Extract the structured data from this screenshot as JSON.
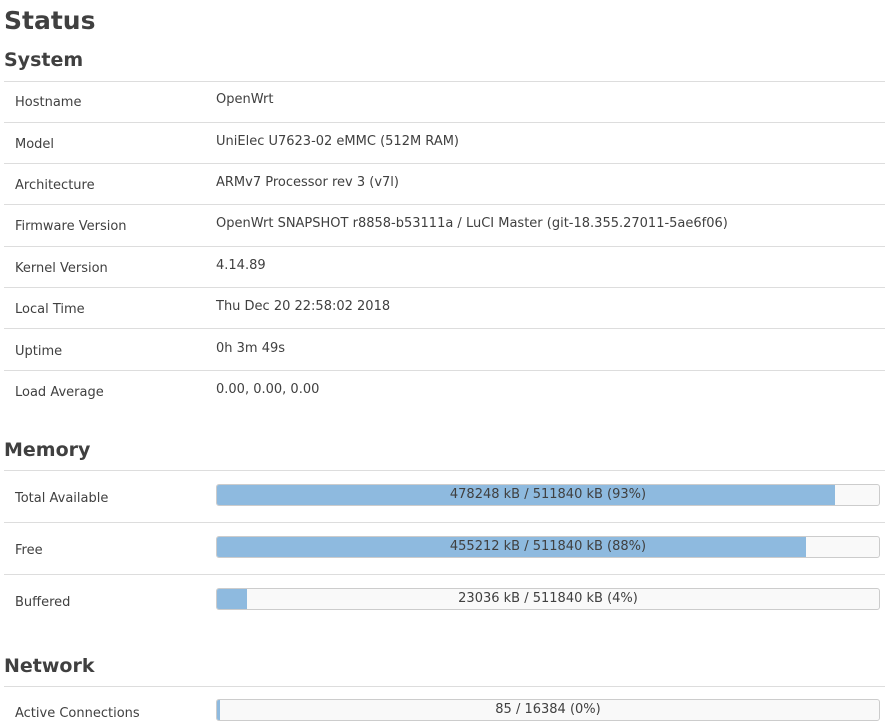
{
  "page": {
    "title": "Status"
  },
  "system": {
    "title": "System",
    "rows": [
      {
        "label": "Hostname",
        "value": "OpenWrt"
      },
      {
        "label": "Model",
        "value": "UniElec U7623-02 eMMC (512M RAM)"
      },
      {
        "label": "Architecture",
        "value": "ARMv7 Processor rev 3 (v7l)"
      },
      {
        "label": "Firmware Version",
        "value": "OpenWrt SNAPSHOT r8858-b53111a / LuCI Master (git-18.355.27011-5ae6f06)"
      },
      {
        "label": "Kernel Version",
        "value": "4.14.89"
      },
      {
        "label": "Local Time",
        "value": "Thu Dec 20 22:58:02 2018"
      },
      {
        "label": "Uptime",
        "value": "0h 3m 49s"
      },
      {
        "label": "Load Average",
        "value": "0.00, 0.00, 0.00"
      }
    ]
  },
  "memory": {
    "title": "Memory",
    "rows": [
      {
        "label": "Total Available",
        "text": "478248 kB / 511840 kB (93%)",
        "fraction": 0.934
      },
      {
        "label": "Free",
        "text": "455212 kB / 511840 kB (88%)",
        "fraction": 0.889
      },
      {
        "label": "Buffered",
        "text": "23036 kB / 511840 kB (4%)",
        "fraction": 0.045
      }
    ]
  },
  "network": {
    "title": "Network",
    "rows": [
      {
        "label": "Active Connections",
        "text": "85 / 16384 (0%)",
        "fraction": 0.005
      }
    ]
  },
  "colors": {
    "bar_fill": "#8ebadf",
    "bar_background": "#f9f9f9",
    "divider": "#dddddd",
    "text": "#404040"
  }
}
